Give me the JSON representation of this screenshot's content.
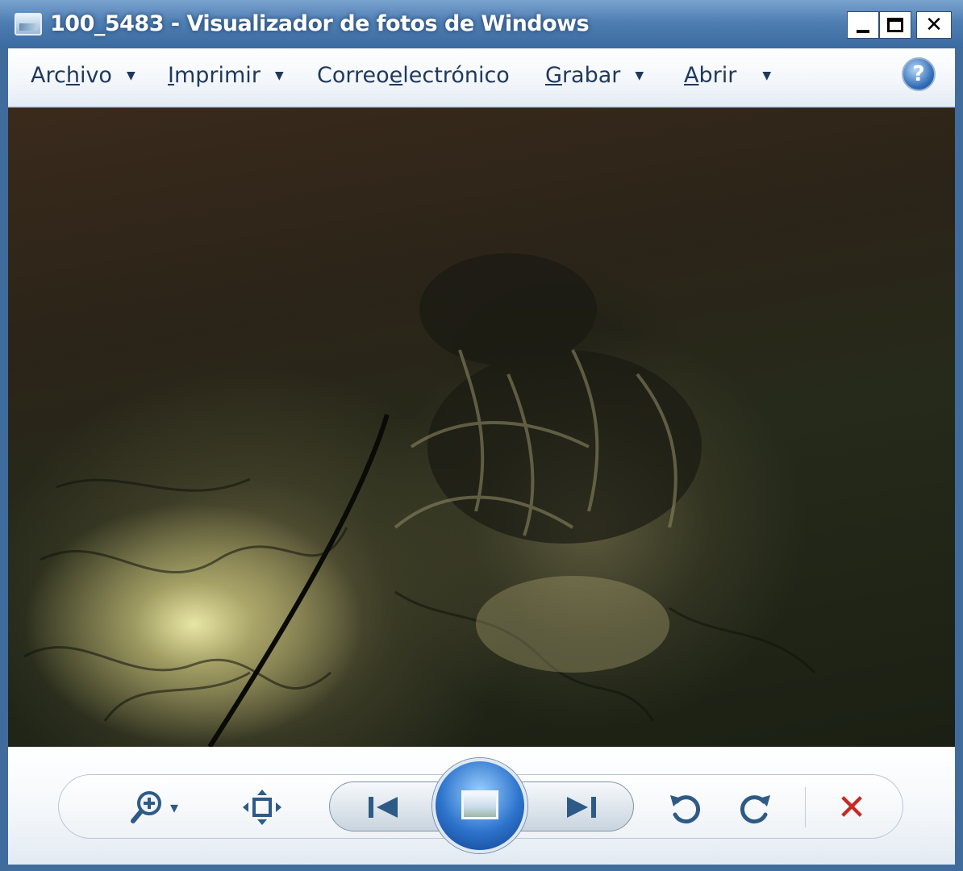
{
  "window": {
    "title": "100_5483 - Visualizador de fotos de Windows",
    "controls": {
      "close": "✕"
    }
  },
  "menu": {
    "items": [
      {
        "pre": "Arc",
        "key": "h",
        "post": "ivo",
        "has_dropdown": true
      },
      {
        "pre": "",
        "key": "I",
        "post": "mprimir",
        "has_dropdown": true
      },
      {
        "pre": "Correo ",
        "key": "e",
        "post": "lectrónico",
        "has_dropdown": false
      },
      {
        "pre": "",
        "key": "G",
        "post": "rabar",
        "has_dropdown": true
      },
      {
        "pre": "",
        "key": "A",
        "post": "brir",
        "has_dropdown": true
      }
    ],
    "dropdown_glyph": "▼",
    "help_glyph": "?"
  },
  "photo": {
    "subject": "dark cave photo",
    "colors": {
      "dark": "#1b2014",
      "light": "#f0eeaa"
    }
  },
  "toolbar": {
    "zoom_glyph": "▾",
    "delete_glyph": "✕",
    "accent_color": "#2e5a86",
    "delete_color": "#c42b24",
    "icons": [
      "zoom-icon",
      "actual-size-icon",
      "previous-icon",
      "slideshow-icon",
      "next-icon",
      "rotate-counterclockwise-icon",
      "rotate-clockwise-icon",
      "delete-icon"
    ]
  }
}
